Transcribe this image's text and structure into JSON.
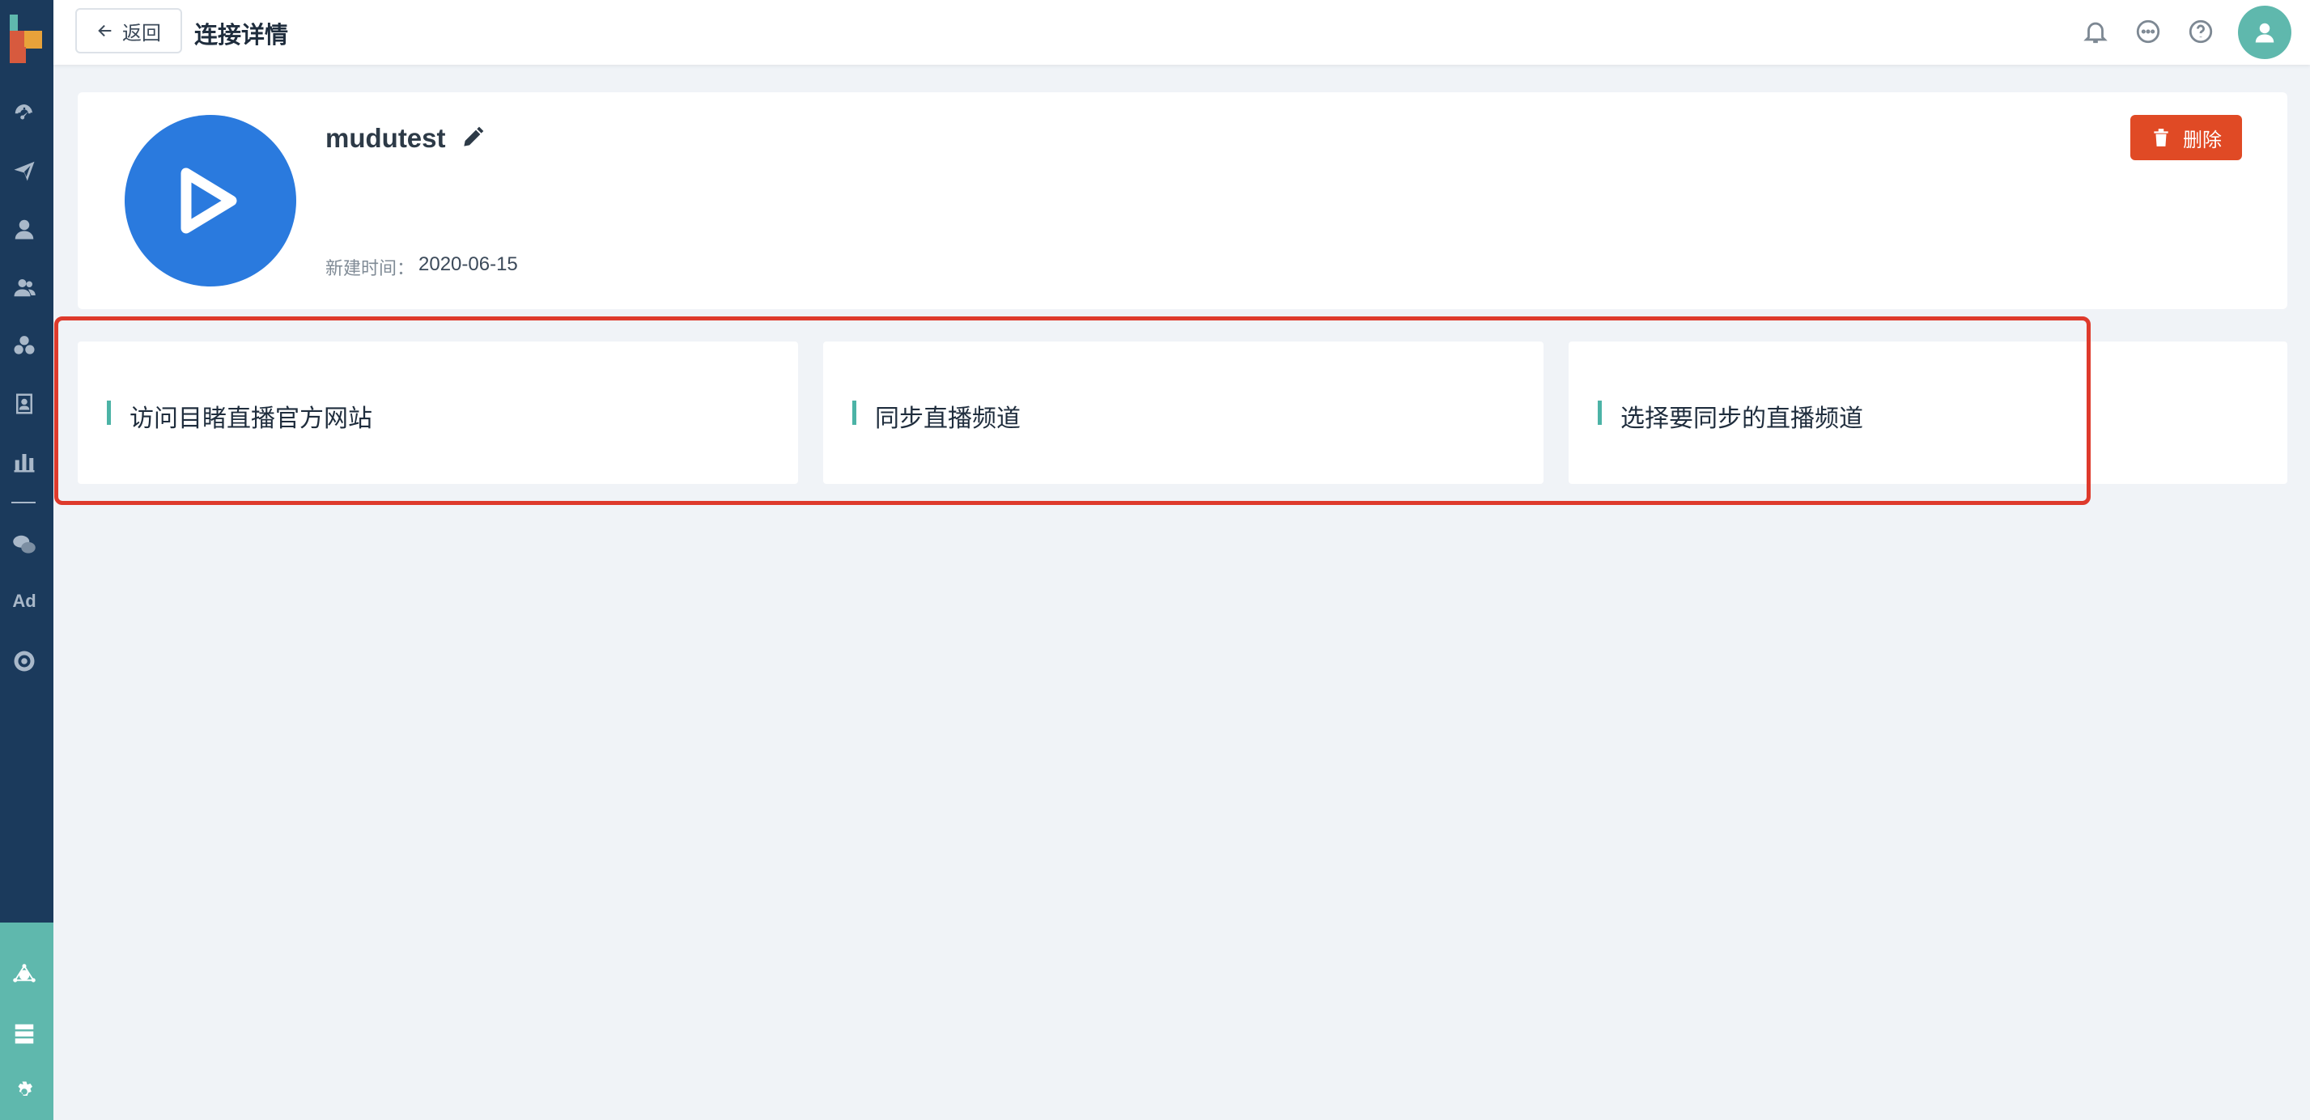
{
  "header": {
    "back_label": "返回",
    "title": "连接详情"
  },
  "profile": {
    "name": "mudutest",
    "created_label": "新建时间：",
    "created_value": "2020-06-15",
    "delete_label": "删除"
  },
  "steps": [
    {
      "label": "访问目睹直播官方网站"
    },
    {
      "label": "同步直播频道"
    },
    {
      "label": "选择要同步的直播频道"
    }
  ],
  "sidebar": {
    "ad_label": "Ad"
  },
  "colors": {
    "sidebar": "#1b3a5c",
    "sidebar_bottom": "#5fb8ad",
    "accent": "#4cb3a6",
    "delete": "#e04a25",
    "logo_blue": "#2a7ade",
    "highlight": "#de3a2c"
  },
  "icons": [
    "dashboard-icon",
    "send-icon",
    "user-icon",
    "users-icon",
    "segments-icon",
    "contact-card-icon",
    "bar-chart-icon",
    "wechat-icon",
    "ad-icon",
    "target-icon",
    "integration-icon",
    "server-icon",
    "settings-icon",
    "bell-icon",
    "chat-icon",
    "help-icon",
    "edit-icon",
    "trash-icon",
    "play-icon"
  ]
}
